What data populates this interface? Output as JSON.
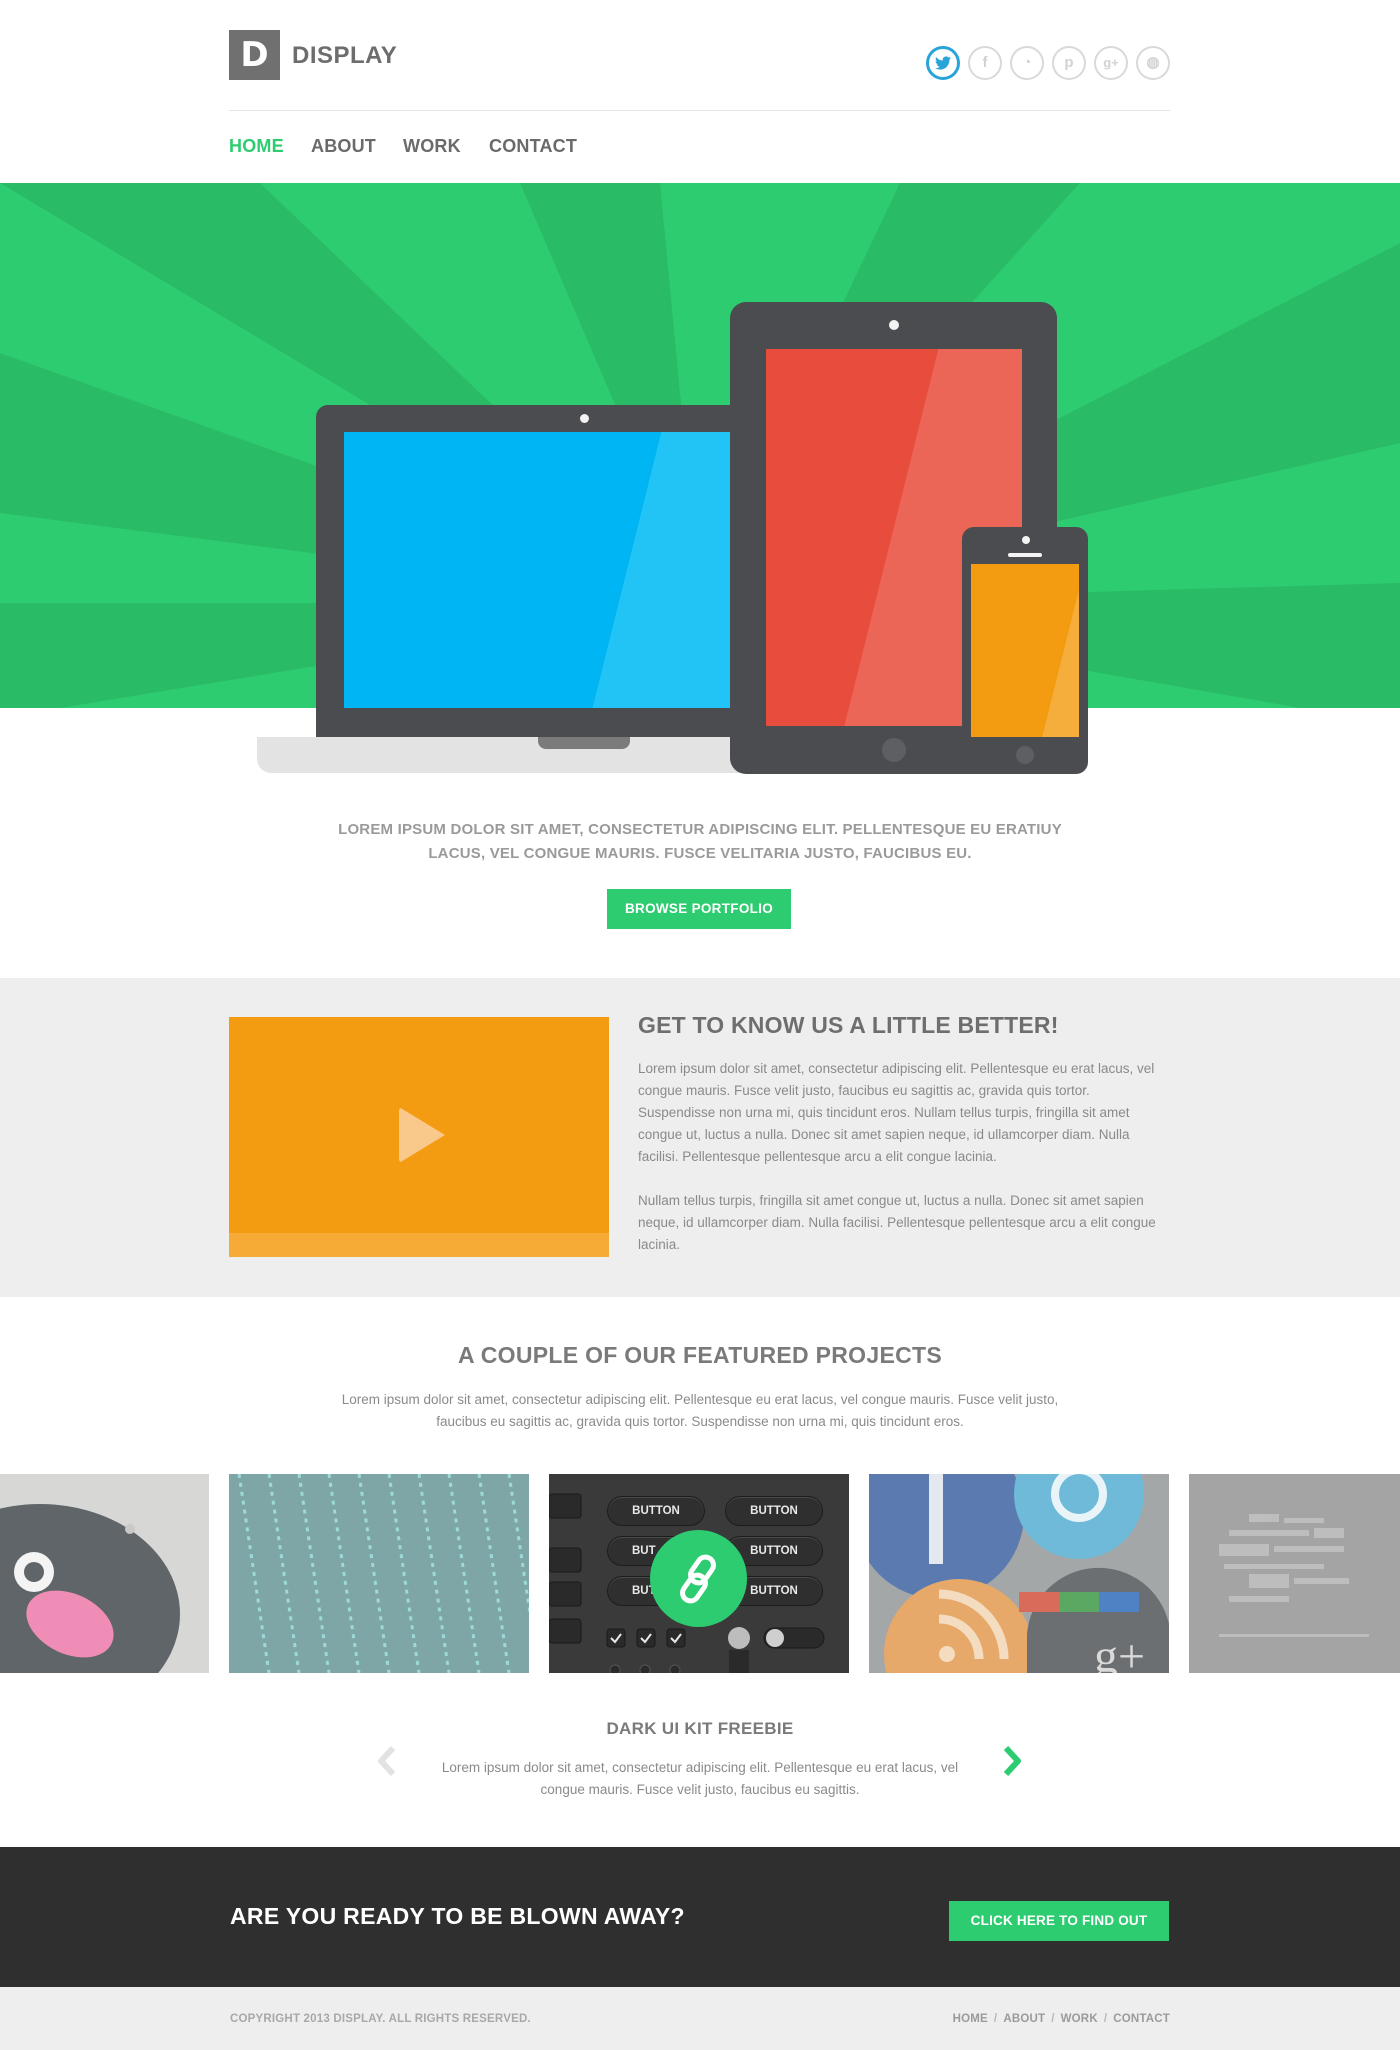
{
  "brand": {
    "logo_letter": "D",
    "name": "DISPLAY"
  },
  "social": [
    {
      "name": "twitter",
      "glyph": "t"
    },
    {
      "name": "facebook",
      "glyph": "f"
    },
    {
      "name": "rss",
      "glyph": "◔"
    },
    {
      "name": "pinterest",
      "glyph": "p"
    },
    {
      "name": "google-plus",
      "glyph": "g+"
    },
    {
      "name": "dribbble",
      "glyph": "◍"
    }
  ],
  "nav": {
    "home": "HOME",
    "about": "ABOUT",
    "work": "WORK",
    "contact": "CONTACT",
    "active": "home"
  },
  "hero": {
    "intro_line1": "LOREM IPSUM DOLOR SIT AMET, CONSECTETUR ADIPISCING ELIT. PELLENTESQUE EU ERATIUY",
    "intro_line2": "LACUS, VEL CONGUE MAURIS. FUSCE VELITARIA JUSTO, FAUCIBUS EU.",
    "button": "BROWSE PORTFOLIO"
  },
  "about": {
    "title": "GET TO KNOW US A LITTLE BETTER!",
    "para1": "Lorem ipsum dolor sit amet, consectetur adipiscing elit. Pellentesque eu erat lacus, vel congue mauris. Fusce velit justo, faucibus eu sagittis ac, gravida quis tortor. Suspendisse non urna mi, quis tincidunt eros. Nullam tellus turpis, fringilla sit amet congue ut, luctus a nulla. Donec sit amet sapien neque, id ullamcorper diam. Nulla facilisi. Pellentesque pellentesque arcu a elit congue lacinia.",
    "para2": "Nullam tellus turpis, fringilla sit amet congue ut, luctus a nulla. Donec sit amet sapien neque, id ullamcorper diam. Nulla facilisi. Pellentesque pellentesque arcu a elit congue lacinia."
  },
  "featured": {
    "title": "A COUPLE OF OUR FEATURED PROJECTS",
    "subtitle": "Lorem ipsum dolor sit amet, consectetur adipiscing elit. Pellentesque eu erat lacus, vel congue mauris. Fusce velit justo, faucibus eu sagittis ac, gravida quis tortor. Suspendisse non urna mi, quis tincidunt eros.",
    "ui_kit_button": "BUTTON",
    "ui_kit_button_partial": "BUT",
    "project_title": "DARK UI KIT FREEBIE",
    "project_desc": "Lorem ipsum dolor sit amet, consectetur adipiscing elit. Pellentesque eu erat lacus, vel congue mauris. Fusce velit justo, faucibus eu sagittis."
  },
  "cta": {
    "text": "ARE YOU READY TO BE BLOWN AWAY?",
    "button": "CLICK HERE TO FIND OUT"
  },
  "footer": {
    "copyright": "COPYRIGHT 2013 DISPLAY. ALL RIGHTS RESERVED.",
    "links": [
      "HOME",
      "ABOUT",
      "WORK",
      "CONTACT"
    ]
  },
  "colors": {
    "accent": "#2ecc71",
    "dark": "#2f2f2f",
    "laptop_screen": "#00b5f3",
    "tablet_screen": "#e74c3c",
    "phone_screen": "#f39c12",
    "twitter": "#29a4d8"
  }
}
